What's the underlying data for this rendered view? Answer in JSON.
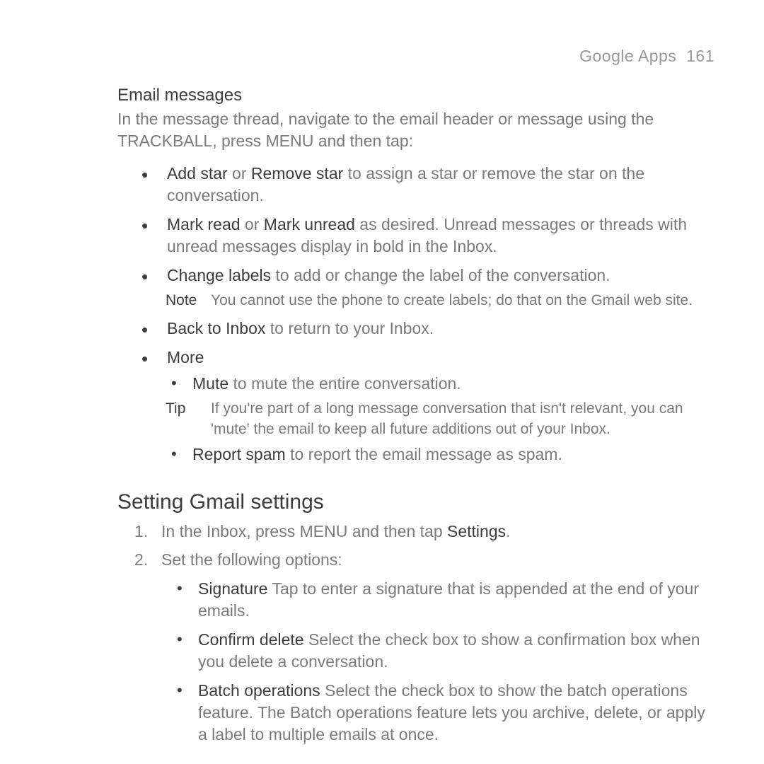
{
  "header": {
    "section": "Google Apps",
    "page": "161"
  },
  "sub1": {
    "title": "Email messages",
    "intro": "In the message thread, navigate to the email header or message using the TRACKBALL, press MENU and then tap:",
    "items": [
      {
        "em1": "Add star",
        "mid1": " or ",
        "em2": "Remove star",
        "rest": " to assign a star or remove the star on the conversation."
      },
      {
        "em1": "Mark read",
        "mid1": " or ",
        "em2": "Mark unread",
        "rest": " as desired. Unread messages or threads with unread messages display in bold in the Inbox."
      },
      {
        "em1": "Change labels",
        "rest": " to add or change the label of the conversation.",
        "note": {
          "label": "Note",
          "body": "You cannot use the phone to create labels; do that on the Gmail web site."
        }
      },
      {
        "em1": "Back to Inbox",
        "rest": " to return to your Inbox."
      },
      {
        "em1": "More",
        "sub": [
          {
            "em1": "Mute",
            "rest": " to mute the entire conversation."
          }
        ],
        "tip": {
          "label": "Tip",
          "body": "If you're part of a long message conversation that isn't relevant, you can 'mute' the email to keep all future additions out of your Inbox."
        },
        "sub2": [
          {
            "em1": "Report spam",
            "rest": " to report the email message as spam."
          }
        ]
      }
    ]
  },
  "sec2": {
    "title": "Setting Gmail settings",
    "steps": [
      {
        "pre": "In the Inbox, press MENU and then tap ",
        "em": "Settings",
        "post": "."
      },
      {
        "pre": "Set the following options:",
        "sub": [
          {
            "em1": "Signature",
            "rest": " Tap to enter a signature that is appended at the end of your emails."
          },
          {
            "em1": "Confirm delete",
            "rest": " Select the check box to show a confirmation box when you delete a conversation."
          },
          {
            "em1": "Batch operations",
            "rest": " Select the check box to show the batch operations feature. The Batch operations feature lets you archive, delete, or apply a label to multiple emails at once."
          }
        ]
      }
    ]
  }
}
